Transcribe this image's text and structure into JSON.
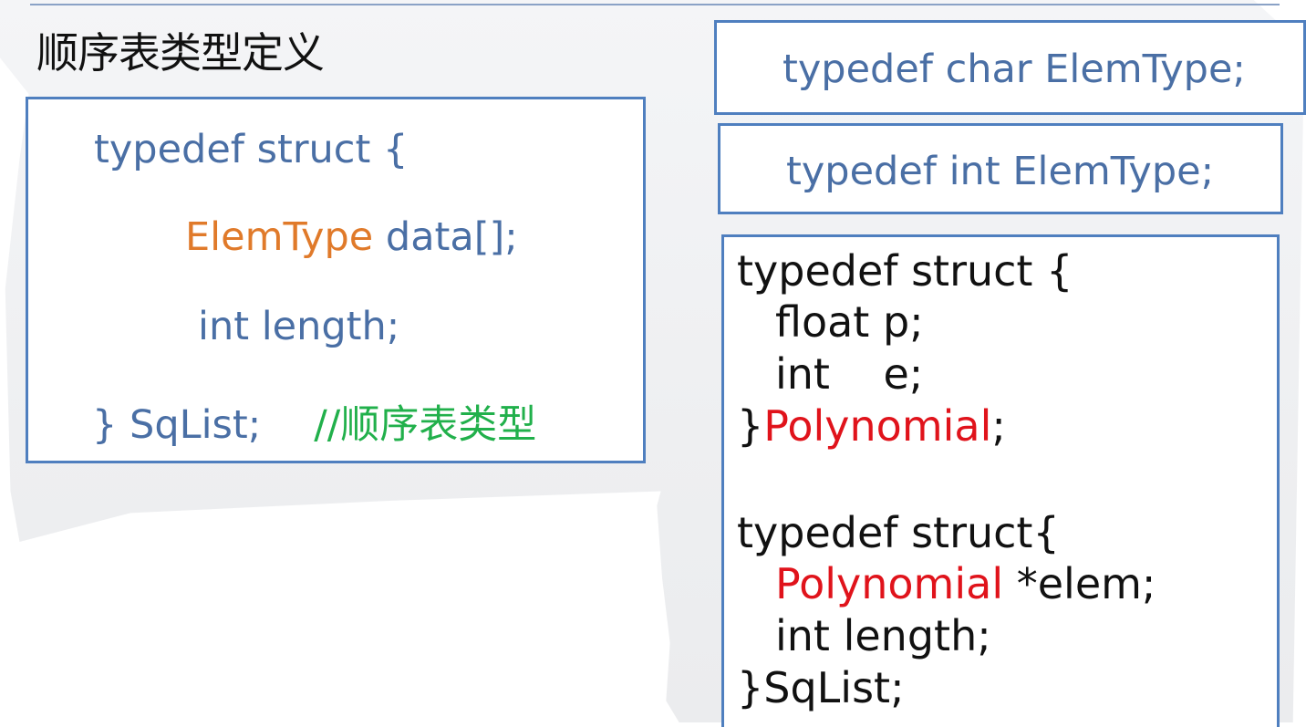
{
  "heading": "顺序表类型定义",
  "left_box": {
    "line1": "typedef struct {",
    "line2_type": "ElemType",
    "line2_rest": " data[];",
    "line3": "int length;",
    "line4_code": "} SqList;",
    "line4_comment": "//顺序表类型"
  },
  "char_box": {
    "text": "typedef char ElemType;"
  },
  "int_box": {
    "text": "typedef int ElemType;"
  },
  "right_box": {
    "l1": "typedef struct {",
    "l2": "float p;",
    "l3": "int    e;",
    "l4_brace": "}",
    "l4_name": "Polynomial",
    "l4_semi": ";",
    "l5": "typedef struct{",
    "l6_type": "Polynomial",
    "l6_rest": " *elem;",
    "l7": "int length;",
    "l8": "}SqList;"
  },
  "colors": {
    "border": "#4f7fbf",
    "code_blue": "#4a6fa5",
    "keyword_orange": "#e07a2a",
    "comment_green": "#21b04b",
    "highlight_red": "#e0131b"
  }
}
